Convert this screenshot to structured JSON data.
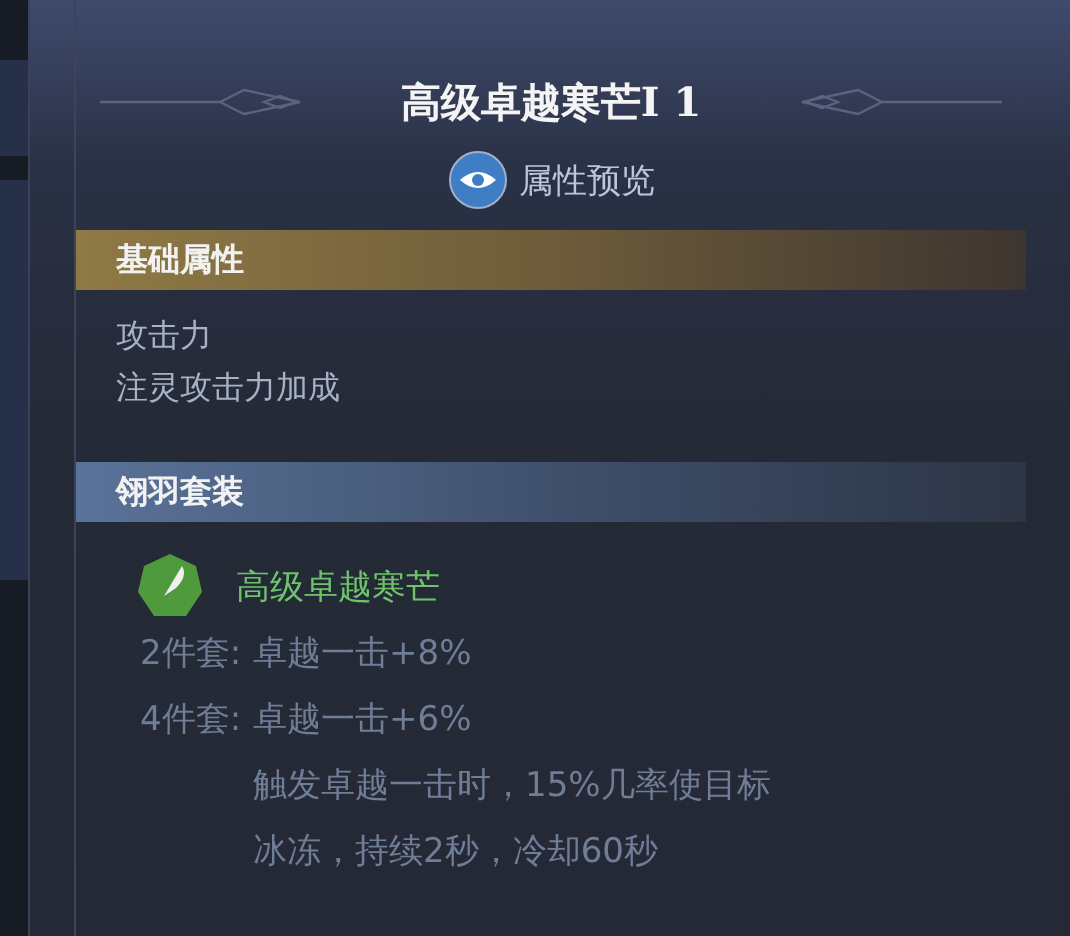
{
  "title": "高级卓越寒芒I 1",
  "preview": {
    "label": "属性预览"
  },
  "sections": [
    {
      "kind": "attributes",
      "title": "基础属性",
      "lines": [
        "攻击力",
        "注灵攻击力加成"
      ]
    },
    {
      "kind": "set",
      "title": "翎羽套装",
      "set_name": "高级卓越寒芒",
      "bonuses": [
        {
          "pieces": "2件套:",
          "lines": [
            "卓越一击+8%"
          ]
        },
        {
          "pieces": "4件套:",
          "lines": [
            "卓越一击+6%",
            "触发卓越一击时，15%几率使目标",
            "冰冻，持续2秒，冷却60秒"
          ]
        }
      ]
    }
  ]
}
